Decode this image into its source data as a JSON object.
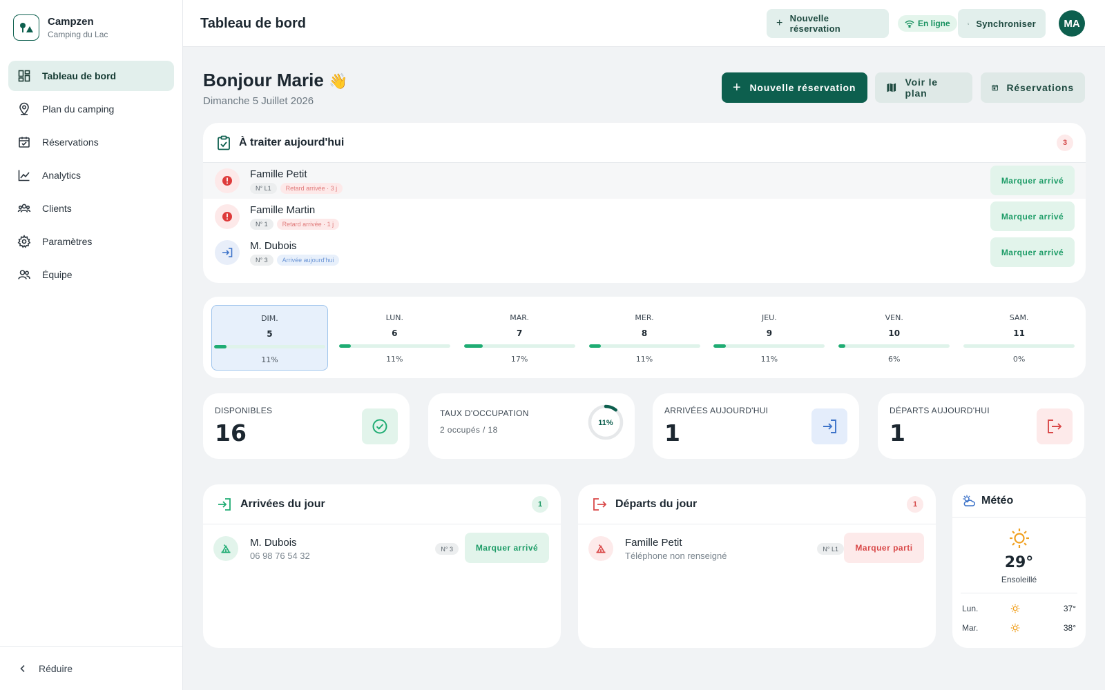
{
  "brand": {
    "name": "Campzen",
    "subtitle": "Camping du Lac"
  },
  "sidebar": {
    "items": [
      {
        "label": "Tableau de bord",
        "icon": "dashboard-icon",
        "active": true
      },
      {
        "label": "Plan du camping",
        "icon": "map-pin-icon"
      },
      {
        "label": "Réservations",
        "icon": "calendar-icon"
      },
      {
        "label": "Analytics",
        "icon": "chart-line-icon"
      },
      {
        "label": "Clients",
        "icon": "users-icon"
      },
      {
        "label": "Paramètres",
        "icon": "gear-icon"
      },
      {
        "label": "Équipe",
        "icon": "team-icon"
      }
    ],
    "collapse_label": "Réduire"
  },
  "topbar": {
    "title": "Tableau de bord",
    "new_booking": "Nouvelle réservation",
    "status": "En ligne",
    "sync": "Synchroniser",
    "avatar": "MA"
  },
  "header": {
    "greeting": "Bonjour Marie",
    "date": "Dimanche 5 Juillet 2026",
    "btn_new": "Nouvelle réservation",
    "btn_plan": "Voir le plan",
    "btn_bookings": "Réservations"
  },
  "todo": {
    "title": "À traiter aujourd'hui",
    "count": "3",
    "rows": [
      {
        "name": "Famille Petit",
        "pitch": "N° L1",
        "status": "Retard arrivée · 3 j",
        "kind": "late",
        "action": "Marquer arrivé"
      },
      {
        "name": "Famille Martin",
        "pitch": "N° 1",
        "status": "Retard arrivée · 1 j",
        "kind": "late",
        "action": "Marquer arrivé"
      },
      {
        "name": "M. Dubois",
        "pitch": "N° 3",
        "status": "Arrivée aujourd'hui",
        "kind": "arrival",
        "action": "Marquer arrivé"
      }
    ]
  },
  "week": [
    {
      "name": "DIM.",
      "num": "5",
      "pct": "11%",
      "fill": 0.11,
      "selected": true
    },
    {
      "name": "LUN.",
      "num": "6",
      "pct": "11%",
      "fill": 0.11
    },
    {
      "name": "MAR.",
      "num": "7",
      "pct": "17%",
      "fill": 0.17
    },
    {
      "name": "MER.",
      "num": "8",
      "pct": "11%",
      "fill": 0.11
    },
    {
      "name": "JEU.",
      "num": "9",
      "pct": "11%",
      "fill": 0.11
    },
    {
      "name": "VEN.",
      "num": "10",
      "pct": "6%",
      "fill": 0.06
    },
    {
      "name": "SAM.",
      "num": "11",
      "pct": "0%",
      "fill": 0.0
    }
  ],
  "stats": {
    "available": {
      "label": "DISPONIBLES",
      "value": "16"
    },
    "occupancy": {
      "label": "TAUX D'OCCUPATION",
      "sub": "2 occupés / 18",
      "pct": "11%",
      "fill": 0.11
    },
    "arrivals": {
      "label": "ARRIVÉES AUJOURD'HUI",
      "value": "1"
    },
    "departures": {
      "label": "DÉPARTS AUJOURD'HUI",
      "value": "1"
    }
  },
  "arrivals": {
    "title": "Arrivées du jour",
    "count": "1",
    "row": {
      "name": "M. Dubois",
      "phone": "06 98 76 54 32",
      "pitch": "N° 3",
      "action": "Marquer arrivé"
    }
  },
  "departures": {
    "title": "Départs du jour",
    "count": "1",
    "row": {
      "name": "Famille Petit",
      "phone": "Téléphone non renseigné",
      "pitch": "N° L1",
      "action": "Marquer parti"
    }
  },
  "weather": {
    "title": "Météo",
    "temp": "29°",
    "desc": "Ensoleillé",
    "forecast": [
      {
        "day": "Lun.",
        "temp": "37°"
      },
      {
        "day": "Mar.",
        "temp": "38°"
      }
    ]
  },
  "colors": {
    "brand": "#0d5f4e",
    "accent_green": "#1fac73",
    "danger": "#d94848",
    "info": "#3d73c9",
    "sun": "#f0a020"
  }
}
